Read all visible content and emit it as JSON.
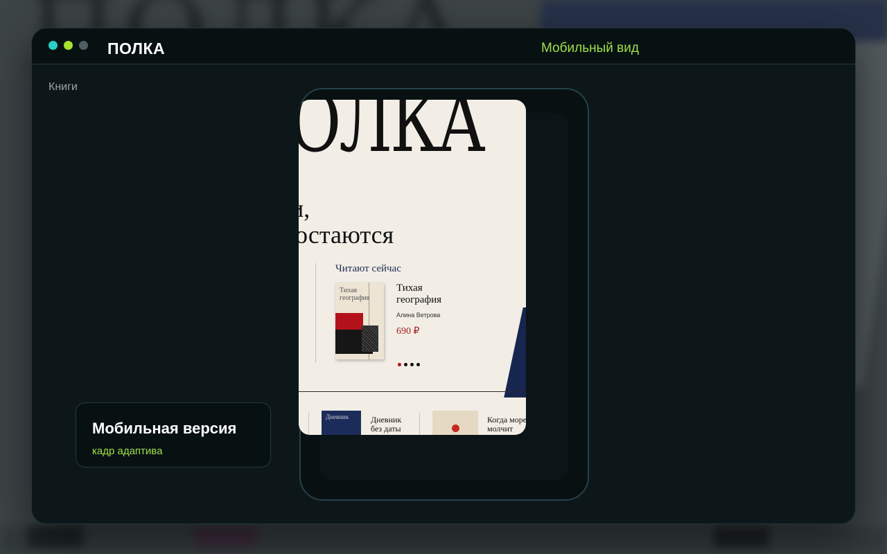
{
  "window": {
    "title": "ПОЛКА",
    "view_mode": "Мобильный вид",
    "section": "Книги",
    "traffic_lights": [
      "#2ad0c7",
      "#a6e22e",
      "#4f5f64"
    ]
  },
  "phone": {
    "hero_word": "ОЛКА",
    "tagline_line1": "и,",
    "tagline_line2": "е остаются",
    "reading_now": {
      "label": "Читают сейчас",
      "cover_text": "Тихая география",
      "title": "Тихая география",
      "author": "Алина Ветрова",
      "price": "690 ₽",
      "pager_dots": 4,
      "pager_active": 0
    },
    "shelf": [
      {
        "title": "Дневник без даты",
        "cover_text": "Дневник",
        "cover_color": "#1c2c5a"
      },
      {
        "title": "Когда море молчит",
        "cover_color": "#e5d9c4"
      }
    ]
  },
  "caption": {
    "title": "Мобильная версия",
    "subtitle": "кадр адаптива"
  },
  "colors": {
    "accent": "#9ee04a",
    "price": "#a41a1f",
    "navy": "#1c2c5a"
  }
}
